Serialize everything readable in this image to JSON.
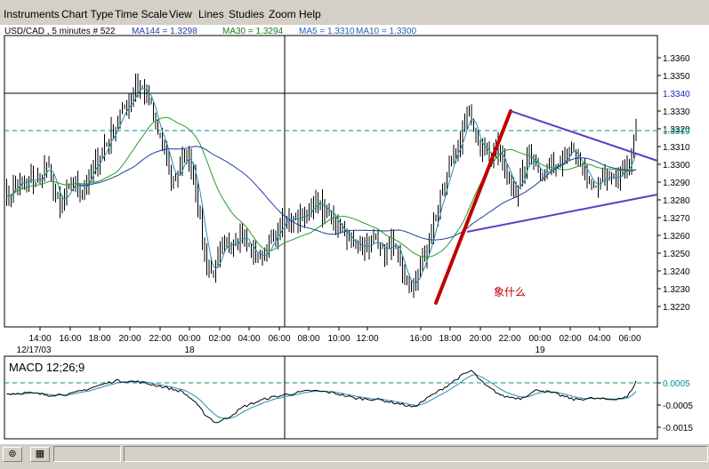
{
  "menu": {
    "items": [
      "Instruments",
      "Chart Type",
      "Time Scale",
      "View",
      "Lines",
      "Studies",
      "Zoom",
      "Help"
    ]
  },
  "header": {
    "symbol_text": "USD/CAD , 5 minutes # 522",
    "ma_labels": [
      {
        "text": "MA144 = 1.3298",
        "color": "#1f3fa0"
      },
      {
        "text": "MA30 = 1.3294",
        "color": "#1a7a1a"
      },
      {
        "text": "MA5 = 1.3310",
        "color": "#2060c0"
      },
      {
        "text": "MA10 = 1.3300",
        "color": "#2060c0"
      }
    ]
  },
  "price_axis": {
    "ticks": [
      "1.3360",
      "1.3350",
      "1.3330",
      "1.3320",
      "1.3310",
      "1.3300",
      "1.3290",
      "1.3280",
      "1.3270",
      "1.3260",
      "1.3250",
      "1.3240",
      "1.3230",
      "1.3220"
    ],
    "tick_values": [
      1.336,
      1.335,
      1.333,
      1.332,
      1.331,
      1.33,
      1.329,
      1.328,
      1.327,
      1.326,
      1.325,
      1.324,
      1.323,
      1.322
    ],
    "crosshair_value": "1.3340",
    "current_value": "1.3319",
    "crosshair_value_num": 1.334,
    "current_value_num": 1.3319
  },
  "time_axis": {
    "labels": [
      "14:00",
      "16:00",
      "18:00",
      "20:00",
      "22:00",
      "00:00",
      "02:00",
      "04:00",
      "06:00",
      "08:00",
      "10:00",
      "12:00",
      "16:00",
      "18:00",
      "20:00",
      "22:00",
      "00:00",
      "02:00",
      "04:00",
      "06:00"
    ],
    "dates": [
      {
        "text": "12/17/03"
      },
      {
        "text": "18"
      },
      {
        "text": "19"
      }
    ]
  },
  "annotation": {
    "text": "象什么",
    "color": "#c00000"
  },
  "macd": {
    "label": "MACD 12;26;9",
    "ticks": [
      "0.0005",
      "-0.0005",
      "-0.0015"
    ],
    "tick_values": [
      0.0005,
      -0.0005,
      -0.0015
    ]
  },
  "colors": {
    "candle": "#000000",
    "ma_fast": "#1f8fb0",
    "ma_mid": "#2a9a2a",
    "ma_slow": "#1f3fa0",
    "trend_red": "#c00000",
    "triangle": "#5a3fc0",
    "dashed": "#009090"
  },
  "statusbar": {
    "icons": [
      "pin-icon",
      "columns-icon"
    ]
  },
  "chart_data": {
    "type": "candlestick",
    "title": "",
    "symbol": "USD/CAD",
    "interval": "5 minutes",
    "bars": 522,
    "ylim": [
      1.3217,
      1.3377
    ],
    "moving_averages": [
      {
        "name": "MA144",
        "value": 1.3298
      },
      {
        "name": "MA30",
        "value": 1.3294
      },
      {
        "name": "MA5",
        "value": 1.331
      },
      {
        "name": "MA10",
        "value": 1.33
      }
    ],
    "price_path_key": [
      [
        0,
        1.3282
      ],
      [
        3,
        1.3285
      ],
      [
        6,
        1.329
      ],
      [
        9,
        1.3288
      ],
      [
        12,
        1.3292
      ],
      [
        15,
        1.329
      ],
      [
        19,
        1.33
      ],
      [
        22,
        1.3288
      ],
      [
        25,
        1.3275
      ],
      [
        28,
        1.3283
      ],
      [
        31,
        1.329
      ],
      [
        35,
        1.3287
      ],
      [
        38,
        1.3293
      ],
      [
        41,
        1.33
      ],
      [
        44,
        1.3308
      ],
      [
        47,
        1.3315
      ],
      [
        50,
        1.3322
      ],
      [
        53,
        1.333
      ],
      [
        56,
        1.3335
      ],
      [
        59,
        1.3345
      ],
      [
        62,
        1.3342
      ],
      [
        65,
        1.3337
      ],
      [
        68,
        1.332
      ],
      [
        71,
        1.3312
      ],
      [
        74,
        1.3298
      ],
      [
        76,
        1.329
      ],
      [
        79,
        1.33
      ],
      [
        82,
        1.3305
      ],
      [
        85,
        1.3295
      ],
      [
        88,
        1.327
      ],
      [
        90,
        1.325
      ],
      [
        93,
        1.3238
      ],
      [
        96,
        1.3245
      ],
      [
        99,
        1.3253
      ],
      [
        103,
        1.3258
      ],
      [
        106,
        1.3262
      ],
      [
        109,
        1.3255
      ],
      [
        112,
        1.325
      ],
      [
        115,
        1.3248
      ],
      [
        118,
        1.3252
      ],
      [
        121,
        1.3258
      ],
      [
        124,
        1.3265
      ],
      [
        128,
        1.327
      ],
      [
        131,
        1.3272
      ],
      [
        134,
        1.3268
      ],
      [
        137,
        1.3276
      ],
      [
        140,
        1.328
      ],
      [
        143,
        1.3274
      ],
      [
        146,
        1.327
      ],
      [
        149,
        1.3266
      ],
      [
        152,
        1.3262
      ],
      [
        155,
        1.3258
      ],
      [
        158,
        1.3254
      ],
      [
        162,
        1.3253
      ],
      [
        165,
        1.3257
      ],
      [
        168,
        1.3252
      ],
      [
        171,
        1.325
      ],
      [
        174,
        1.3258
      ],
      [
        177,
        1.3248
      ],
      [
        180,
        1.3238
      ],
      [
        183,
        1.323
      ],
      [
        186,
        1.3238
      ],
      [
        189,
        1.325
      ],
      [
        192,
        1.3262
      ],
      [
        195,
        1.3278
      ],
      [
        198,
        1.329
      ],
      [
        201,
        1.33
      ],
      [
        204,
        1.331
      ],
      [
        207,
        1.3322
      ],
      [
        209,
        1.333
      ],
      [
        212,
        1.3318
      ],
      [
        215,
        1.331
      ],
      [
        218,
        1.3305
      ],
      [
        221,
        1.331
      ],
      [
        224,
        1.33
      ],
      [
        227,
        1.329
      ],
      [
        230,
        1.3285
      ],
      [
        233,
        1.3295
      ],
      [
        236,
        1.3305
      ],
      [
        239,
        1.33
      ],
      [
        242,
        1.3295
      ],
      [
        245,
        1.3298
      ],
      [
        248,
        1.33
      ],
      [
        251,
        1.3305
      ],
      [
        254,
        1.331
      ],
      [
        257,
        1.3302
      ],
      [
        260,
        1.3295
      ],
      [
        263,
        1.329
      ],
      [
        266,
        1.3288
      ],
      [
        269,
        1.3292
      ],
      [
        272,
        1.329
      ],
      [
        275,
        1.329
      ],
      [
        278,
        1.3295
      ],
      [
        281,
        1.33
      ],
      [
        283,
        1.331
      ],
      [
        284,
        1.332
      ]
    ],
    "trendline_red": [
      [
        1.3222,
        "16:00"
      ],
      [
        1.333,
        "22:00"
      ]
    ],
    "macd": {
      "params": "12;26;9",
      "ylim": [
        -0.002,
        0.0012
      ],
      "path_key": [
        [
          0,
          0.0
        ],
        [
          10,
          5e-05
        ],
        [
          20,
          -5e-05
        ],
        [
          30,
          0.0
        ],
        [
          40,
          0.0003
        ],
        [
          50,
          0.0006
        ],
        [
          60,
          0.00055
        ],
        [
          70,
          0.00035
        ],
        [
          80,
          0.0001
        ],
        [
          85,
          -0.0003
        ],
        [
          90,
          -0.0009
        ],
        [
          95,
          -0.0013
        ],
        [
          100,
          -0.0011
        ],
        [
          108,
          -0.00055
        ],
        [
          118,
          -0.0002
        ],
        [
          128,
          0.0
        ],
        [
          138,
          0.00015
        ],
        [
          148,
          5e-05
        ],
        [
          158,
          -0.0002
        ],
        [
          168,
          -0.00025
        ],
        [
          178,
          -0.00045
        ],
        [
          184,
          -0.0006
        ],
        [
          190,
          -0.0002
        ],
        [
          198,
          0.0003
        ],
        [
          206,
          0.00085
        ],
        [
          210,
          0.00105
        ],
        [
          216,
          0.0004
        ],
        [
          224,
          -0.0001
        ],
        [
          232,
          -0.0002
        ],
        [
          240,
          0.0002
        ],
        [
          248,
          0.0
        ],
        [
          256,
          -0.00025
        ],
        [
          264,
          -0.0002
        ],
        [
          272,
          -0.00025
        ],
        [
          280,
          -0.00015
        ],
        [
          284,
          0.00055
        ]
      ]
    }
  }
}
